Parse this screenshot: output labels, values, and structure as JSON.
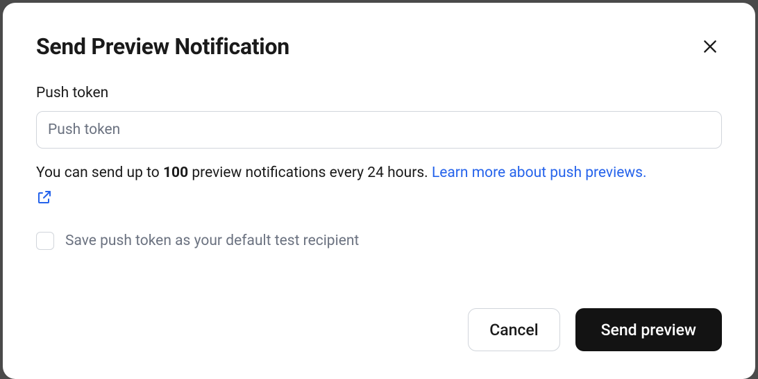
{
  "modal": {
    "title": "Send Preview Notification",
    "pushToken": {
      "label": "Push token",
      "placeholder": "Push token",
      "value": ""
    },
    "helpText": {
      "prefix": "You can send up to ",
      "limit": "100",
      "suffix": " preview notifications every 24 hours. ",
      "linkText": "Learn more about push previews."
    },
    "checkbox": {
      "label": "Save push token as your default test recipient"
    },
    "buttons": {
      "cancel": "Cancel",
      "submit": "Send preview"
    }
  }
}
